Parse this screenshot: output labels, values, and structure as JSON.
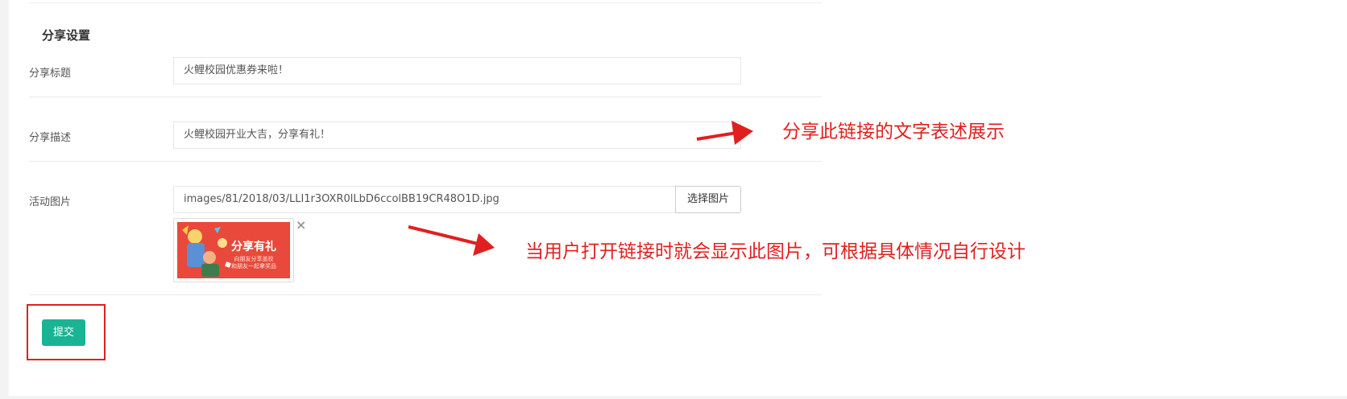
{
  "section": {
    "title": "分享设置"
  },
  "fields": {
    "share_title": {
      "label": "分享标题",
      "value": "火鲤校园优惠券来啦！"
    },
    "share_desc": {
      "label": "分享描述",
      "value": "火鲤校园开业大吉，分享有礼！"
    },
    "activity_image": {
      "label": "活动图片",
      "value": "images/81/2018/03/LLI1r3OXR0lLbD6ccolBB19CR48O1D.jpg",
      "pick_label": "选择图片",
      "remove_symbol": "×",
      "preview": {
        "headline": "分享有礼",
        "line1": "向朋友分享盖校",
        "line2": "和朋友一起拿奖品",
        "bg_color": "#e8493a"
      }
    }
  },
  "actions": {
    "submit_label": "提交"
  },
  "annotations": {
    "desc_note": "分享此链接的文字表述展示",
    "image_note": "当用户打开链接时就会显示此图片，可根据具体情况自行设计"
  },
  "colors": {
    "accent": "#1ab394",
    "annotation_red": "#e02020"
  }
}
